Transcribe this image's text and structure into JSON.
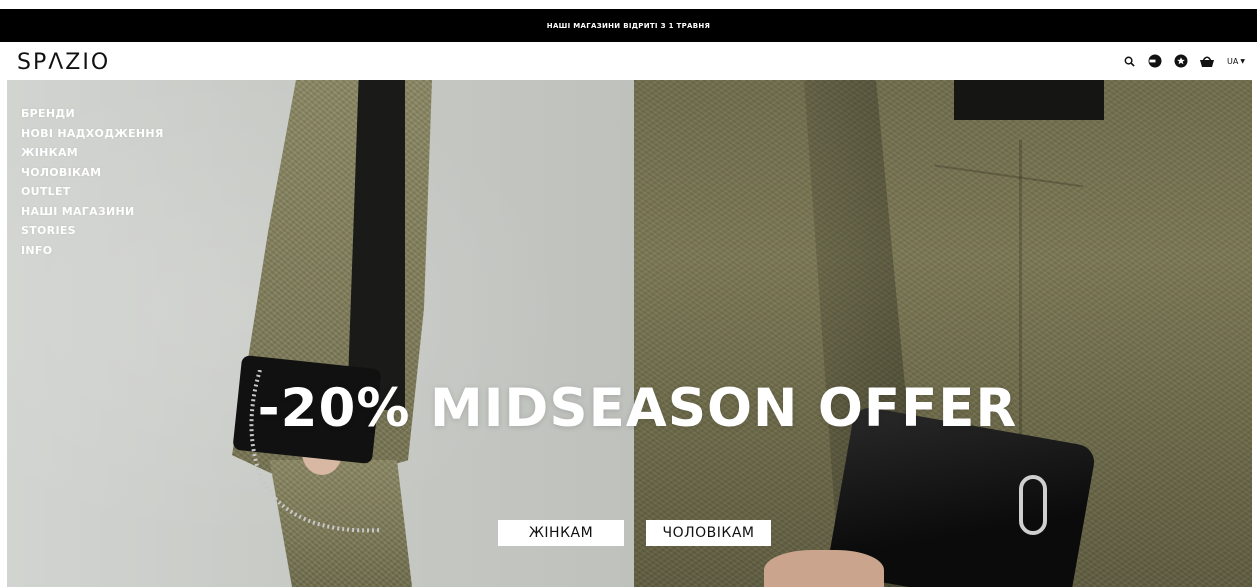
{
  "announcement": {
    "text": "НАШІ МАГАЗИНИ ВІДРИТІ З 1 ТРАВНЯ"
  },
  "brand": {
    "logo_text": "SPΛZIO"
  },
  "header": {
    "icons": [
      "search-icon",
      "account-icon",
      "wishlist-icon",
      "cart-icon"
    ],
    "language": "UA"
  },
  "nav": {
    "items": [
      "БРЕНДИ",
      "НОВІ НАДХОДЖЕННЯ",
      "ЖІНКАМ",
      "ЧОЛОВІКАМ",
      "OUTLET",
      "НАШІ МАГАЗИНИ",
      "STORIES",
      "INFO"
    ]
  },
  "hero": {
    "headline": "-20% MIDSEASON OFFER",
    "cta_women": "ЖІНКАМ",
    "cta_men": "ЧОЛОВІКАМ"
  },
  "colors": {
    "announcement_bg": "#000000",
    "text_dark": "#111111",
    "text_light": "#ffffff"
  }
}
